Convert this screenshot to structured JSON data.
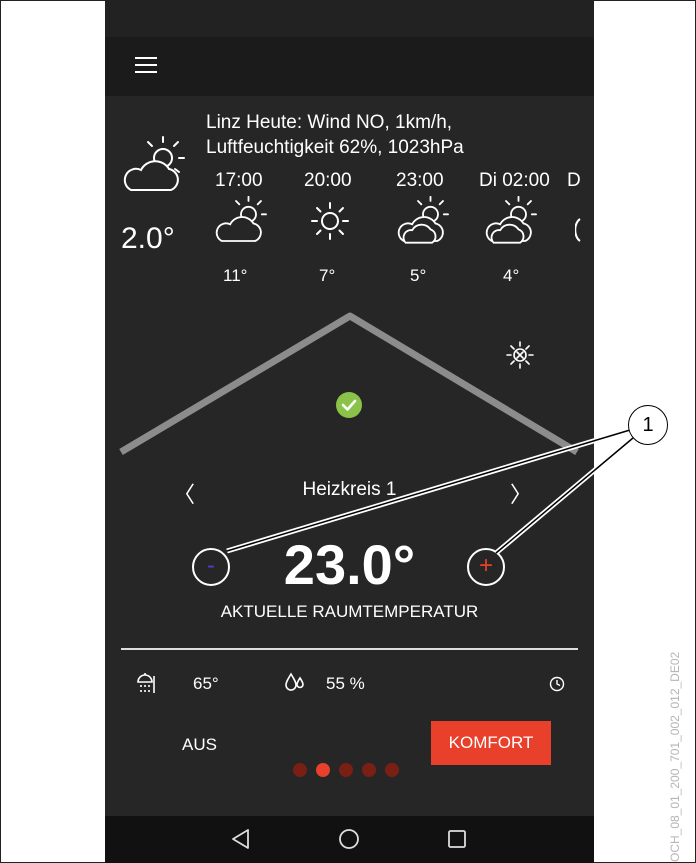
{
  "weather": {
    "line1": "Linz Heute: Wind NO, 1km/h,",
    "line2": "Luftfeuchtigkeit 62%, 1023hPa",
    "current_temp": "2.0°",
    "forecast": [
      {
        "time": "17:00",
        "temp": "11°",
        "icon": "partly-cloudy-icon"
      },
      {
        "time": "20:00",
        "temp": "7°",
        "icon": "sun-icon"
      },
      {
        "time": "23:00",
        "temp": "5°",
        "icon": "partly-cloudy-icon"
      },
      {
        "time": "Di 02:00",
        "temp": "4°",
        "icon": "partly-cloudy-icon"
      },
      {
        "time": "D",
        "temp": "",
        "icon": "partly-cloudy-icon"
      }
    ]
  },
  "circuit": {
    "name": "Heizkreis 1",
    "prev": "〈",
    "next": "〉",
    "status_icon": "check-icon",
    "mode_icon": "sun-snowflake-icon"
  },
  "temperature": {
    "value": "23.0°",
    "label": "AKTUELLE RAUMTEMPERATUR",
    "minus": "-",
    "plus": "+"
  },
  "info": {
    "hot_water": "65°",
    "humidity": "55 %",
    "hot_water_icon": "shower-icon",
    "humidity_icon": "drops-icon",
    "clock_icon": "clock-icon"
  },
  "modes": {
    "off": "AUS",
    "comfort": "KOMFORT"
  },
  "pager": {
    "count": 5,
    "active": 1
  },
  "annotation": {
    "callout": "1",
    "code": "OCH_08_01_200_701_002_012_DE02"
  },
  "colors": {
    "background": "#262626",
    "accent": "#e8402a",
    "check": "#8bc34a",
    "roof": "#8c8c8c",
    "minus": "#4b3fcf",
    "plus": "#e8402a"
  }
}
